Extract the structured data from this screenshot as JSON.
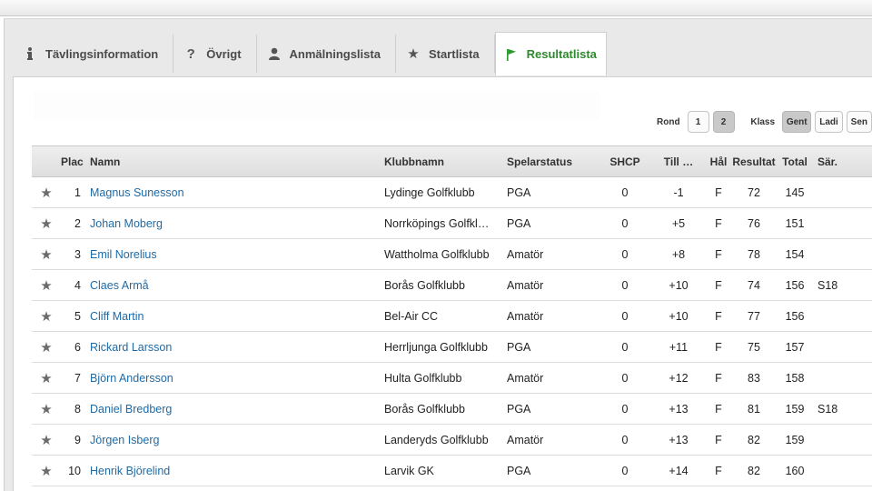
{
  "tabs": [
    {
      "label": "Tävlingsinformation",
      "icon": "info-icon",
      "active": false
    },
    {
      "label": "Övrigt",
      "icon": "question-icon",
      "active": false
    },
    {
      "label": "Anmälningslista",
      "icon": "person-icon",
      "active": false
    },
    {
      "label": "Startlista",
      "icon": "star-icon",
      "active": false
    },
    {
      "label": "Resultatlista",
      "icon": "flag-icon",
      "active": true
    }
  ],
  "controls": {
    "rond_label": "Rond",
    "rounds": [
      "1",
      "2"
    ],
    "selected_round": "2",
    "klass_label": "Klass",
    "classes": [
      "Gent",
      "Ladi",
      "Sen"
    ],
    "selected_class": "Gent"
  },
  "table": {
    "headers": {
      "plac": "Plac",
      "namn": "Namn",
      "klubb": "Klubbnamn",
      "status": "Spelarstatus",
      "shcp": "SHCP",
      "till": "Till …",
      "hal": "Hål",
      "resultat": "Resultat",
      "total": "Total",
      "sar": "Sär."
    },
    "rows": [
      {
        "plac": "1",
        "namn": "Magnus Sunesson",
        "klubb": "Lydinge Golfklubb",
        "status": "PGA",
        "shcp": "0",
        "till": "-1",
        "hal": "F",
        "resultat": "72",
        "total": "145",
        "sar": ""
      },
      {
        "plac": "2",
        "namn": "Johan Moberg",
        "klubb": "Norrköpings Golfkl…",
        "status": "PGA",
        "shcp": "0",
        "till": "+5",
        "hal": "F",
        "resultat": "76",
        "total": "151",
        "sar": ""
      },
      {
        "plac": "3",
        "namn": "Emil Norelius",
        "klubb": "Wattholma Golfklubb",
        "status": "Amatör",
        "shcp": "0",
        "till": "+8",
        "hal": "F",
        "resultat": "78",
        "total": "154",
        "sar": ""
      },
      {
        "plac": "4",
        "namn": "Claes Armå",
        "klubb": "Borås Golfklubb",
        "status": "Amatör",
        "shcp": "0",
        "till": "+10",
        "hal": "F",
        "resultat": "74",
        "total": "156",
        "sar": "S18"
      },
      {
        "plac": "5",
        "namn": "Cliff Martin",
        "klubb": "Bel-Air CC",
        "status": "Amatör",
        "shcp": "0",
        "till": "+10",
        "hal": "F",
        "resultat": "77",
        "total": "156",
        "sar": ""
      },
      {
        "plac": "6",
        "namn": "Rickard Larsson",
        "klubb": "Herrljunga Golfklubb",
        "status": "PGA",
        "shcp": "0",
        "till": "+11",
        "hal": "F",
        "resultat": "75",
        "total": "157",
        "sar": ""
      },
      {
        "plac": "7",
        "namn": "Björn Andersson",
        "klubb": "Hulta Golfklubb",
        "status": "Amatör",
        "shcp": "0",
        "till": "+12",
        "hal": "F",
        "resultat": "83",
        "total": "158",
        "sar": ""
      },
      {
        "plac": "8",
        "namn": "Daniel Bredberg",
        "klubb": "Borås Golfklubb",
        "status": "PGA",
        "shcp": "0",
        "till": "+13",
        "hal": "F",
        "resultat": "81",
        "total": "159",
        "sar": "S18"
      },
      {
        "plac": "9",
        "namn": "Jörgen Isberg",
        "klubb": "Landeryds Golfklubb",
        "status": "Amatör",
        "shcp": "0",
        "till": "+13",
        "hal": "F",
        "resultat": "82",
        "total": "159",
        "sar": ""
      },
      {
        "plac": "10",
        "namn": "Henrik Björelind",
        "klubb": "Larvik GK",
        "status": "PGA",
        "shcp": "0",
        "till": "+14",
        "hal": "F",
        "resultat": "82",
        "total": "160",
        "sar": ""
      }
    ]
  },
  "colors": {
    "active_tab": "#2d8a2d",
    "link": "#1f6aa5",
    "header_bg": "#e4e4e4"
  }
}
